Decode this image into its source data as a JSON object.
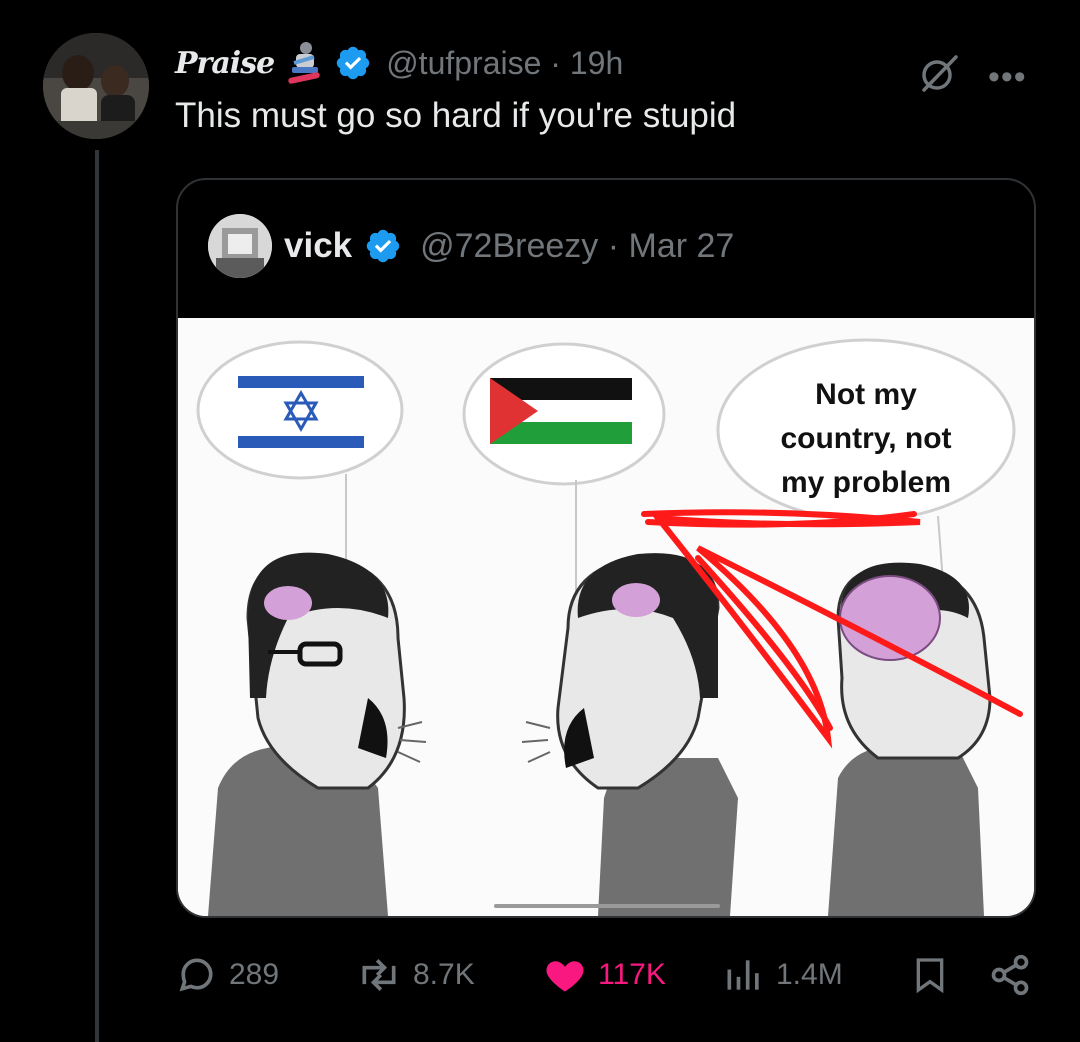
{
  "post": {
    "display_name": "Praise",
    "handle": "@tufpraise",
    "time": "19h",
    "text": "This must go so hard if you're stupid"
  },
  "quote": {
    "display_name": "vick",
    "handle": "@72Breezy",
    "date": "Mar 27",
    "media_caption": "Not my country, not my problem"
  },
  "actions": {
    "replies": "289",
    "reposts": "8.7K",
    "likes": "117K",
    "views": "1.4M"
  },
  "colors": {
    "background": "#000000",
    "secondary_text": "#71767b",
    "like_pink": "#f91880",
    "verified_blue": "#1d9bf0",
    "scribble_red": "#ff1a1a"
  },
  "icons": [
    "grok-icon",
    "more-icon",
    "verified-icon",
    "snowboarder-icon",
    "reply-icon",
    "repost-icon",
    "like-icon",
    "views-icon",
    "bookmark-icon",
    "share-icon"
  ]
}
